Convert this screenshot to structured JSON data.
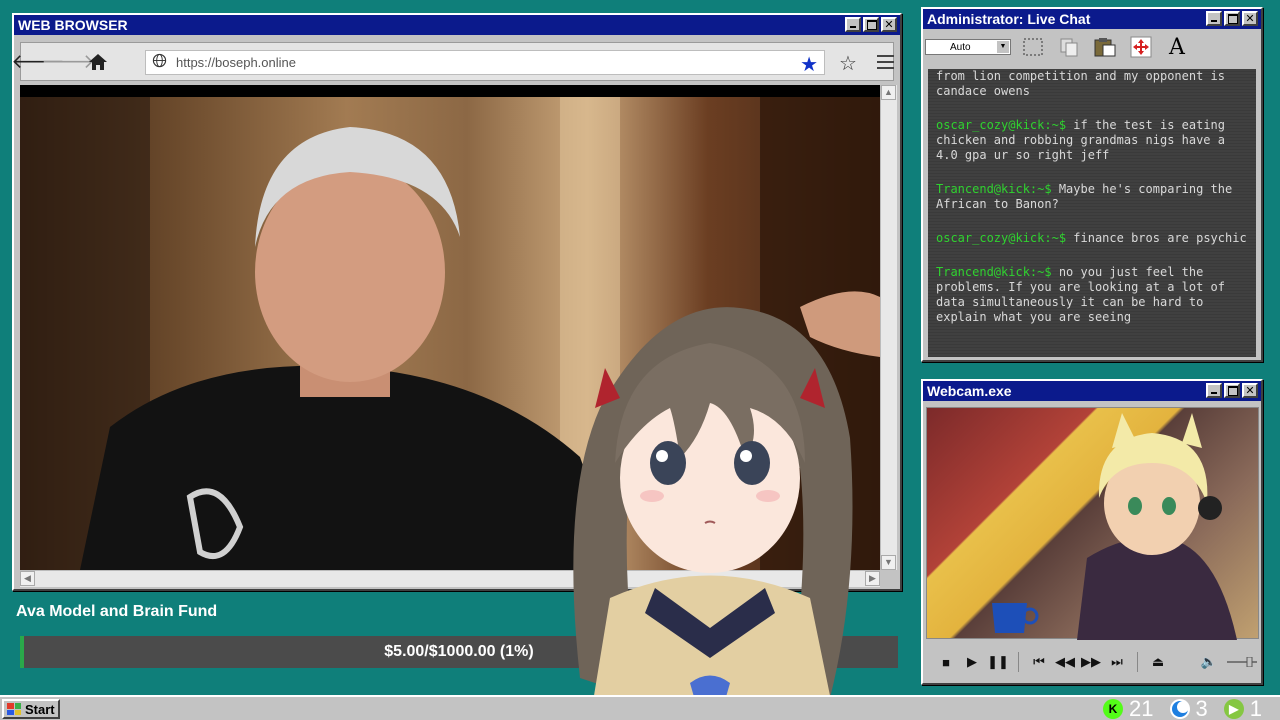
{
  "browser": {
    "title": "WEB BROWSER",
    "url": "https://boseph.online"
  },
  "chat": {
    "title": "Administrator: Live Chat",
    "font_size_value": "Auto",
    "messages": [
      {
        "user": "",
        "text": "from lion competition and my opponent is candace owens"
      },
      {
        "user": "oscar_cozy@kick:~$",
        "text": "if the test is eating chicken and robbing grandmas nigs have a 4.0 gpa ur so right jeff"
      },
      {
        "user": "Trancend@kick:~$",
        "text": "Maybe he's comparing the African to Banon?"
      },
      {
        "user": "oscar_cozy@kick:~$",
        "text": "finance bros are psychic"
      },
      {
        "user": "Trancend@kick:~$",
        "text": "no you just feel the problems. If you are looking at a lot of data simultaneously it can be hard to explain what you are seeing"
      }
    ]
  },
  "webcam": {
    "title": "Webcam.exe"
  },
  "fund": {
    "title": "Ava Model and Brain Fund",
    "progress_text": "$5.00/$1000.00 (1%)",
    "progress_fraction": 0.005,
    "fill_color": "#2aa84a"
  },
  "taskbar": {
    "start_label": "Start",
    "tray": [
      {
        "icon": "kick-icon",
        "value": "21",
        "color": "#53fc18"
      },
      {
        "icon": "crescent-icon",
        "value": "3",
        "color": "#1e7fe0"
      },
      {
        "icon": "rumble-icon",
        "value": "1",
        "color": "#85c742"
      }
    ]
  },
  "colors": {
    "desktop": "#0f7f7a",
    "titlebar": "#0b1a8c",
    "chat_user": "#2fd22f"
  }
}
